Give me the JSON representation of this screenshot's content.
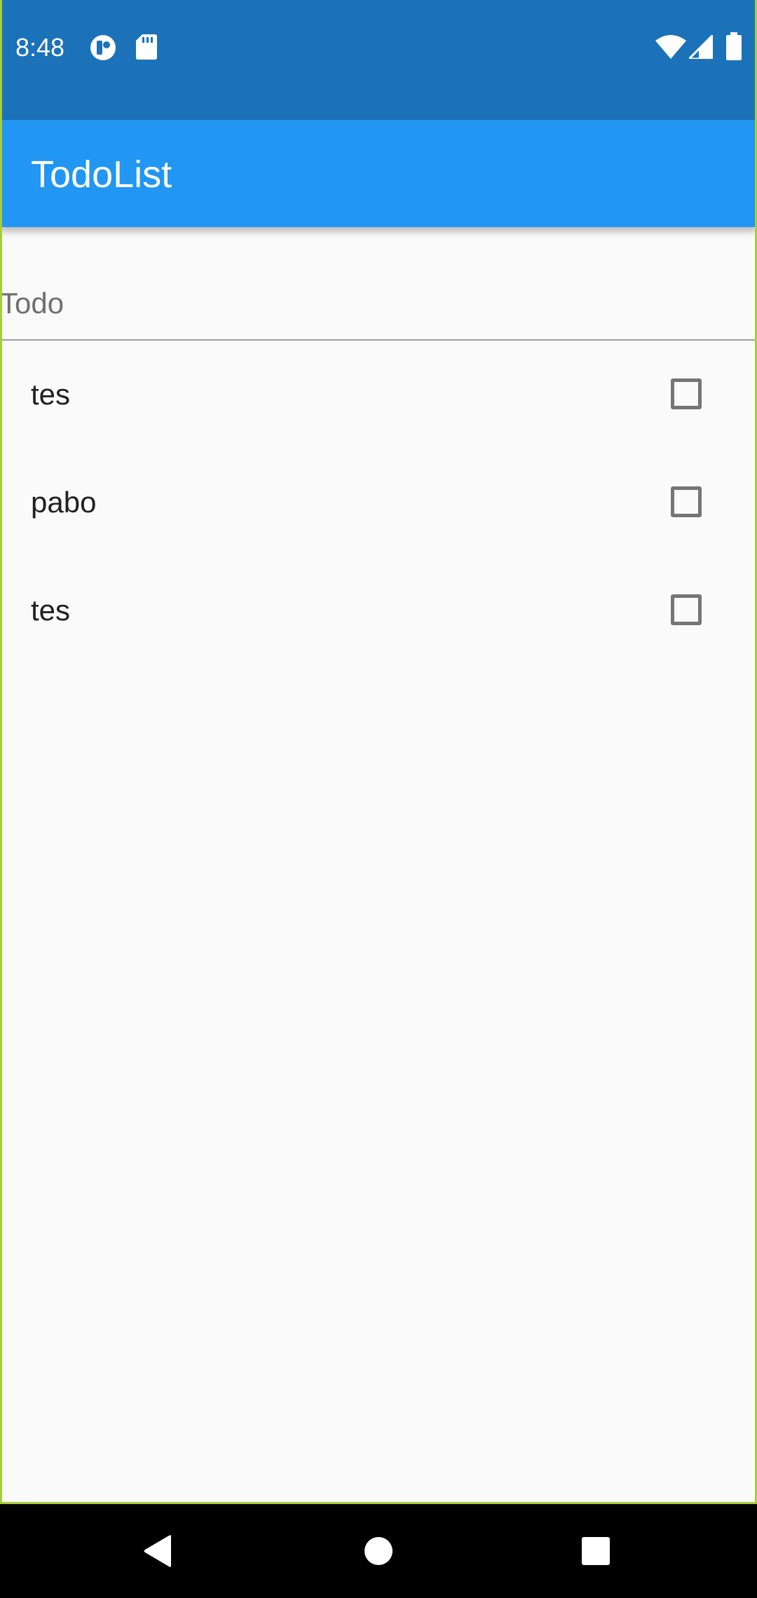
{
  "status_bar": {
    "time": "8:48",
    "left_icons": [
      "app-notification-icon",
      "sd-card-icon"
    ],
    "right_icons": [
      "wifi-icon",
      "cell-signal-icon",
      "battery-icon"
    ],
    "color": "#1b72b9"
  },
  "app_bar": {
    "title": "TodoList",
    "color": "#2196f3"
  },
  "todo_input": {
    "placeholder": "Todo",
    "value": ""
  },
  "todos": [
    {
      "text": "tes",
      "checked": false
    },
    {
      "text": "pabo",
      "checked": false
    },
    {
      "text": "tes",
      "checked": false
    }
  ],
  "nav_bar": {
    "buttons": [
      "back-icon",
      "home-icon",
      "recents-icon"
    ]
  }
}
